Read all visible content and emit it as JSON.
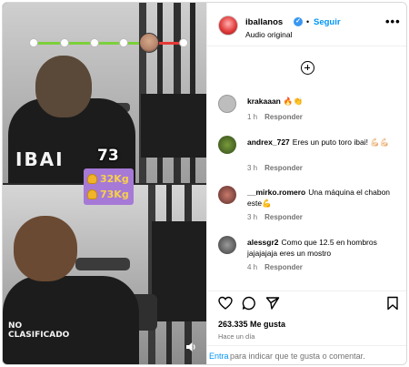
{
  "media": {
    "rep_count": "73",
    "weights": [
      "32Kg",
      "73Kg"
    ],
    "shirt_text_top": "IBAI",
    "shirt_text_bottom": "NO\nCLASIFICADO",
    "colors": {
      "weight_box": "#a679d6",
      "weight_text": "#f7d14a",
      "track_green": "#7bd03b",
      "track_red": "#e53935"
    },
    "icons": [
      "muscle-icon",
      "volume-icon"
    ]
  },
  "header": {
    "username": "iballanos",
    "follow_label": "Seguir",
    "separator": "•",
    "audio_label": "Audio original",
    "more_label": "•••"
  },
  "comments": [
    {
      "user": "krakaaan",
      "text": "🔥👏",
      "time": "1 h",
      "reply": "Responder"
    },
    {
      "user": "andrex_727",
      "text": "Eres un puto toro ibai! 💪🏻💪🏻",
      "time": "3 h",
      "reply": "Responder"
    },
    {
      "user": "__mirko.romero",
      "text": "Una máquina el chabon este💪",
      "time": "3 h",
      "reply": "Responder"
    },
    {
      "user": "alessgr2",
      "text": "Como que 12.5 en hombros jajajajaja eres un mostro",
      "time": "4 h",
      "reply": "Responder"
    }
  ],
  "actions": {
    "likes": "263.335 Me gusta",
    "timestamp": "Hace un día",
    "icons": [
      "heart-icon",
      "comment-icon",
      "share-icon",
      "bookmark-icon"
    ]
  },
  "comment_input": {
    "enter_label": "Entra",
    "placeholder": "para indicar que te gusta o comentar."
  }
}
